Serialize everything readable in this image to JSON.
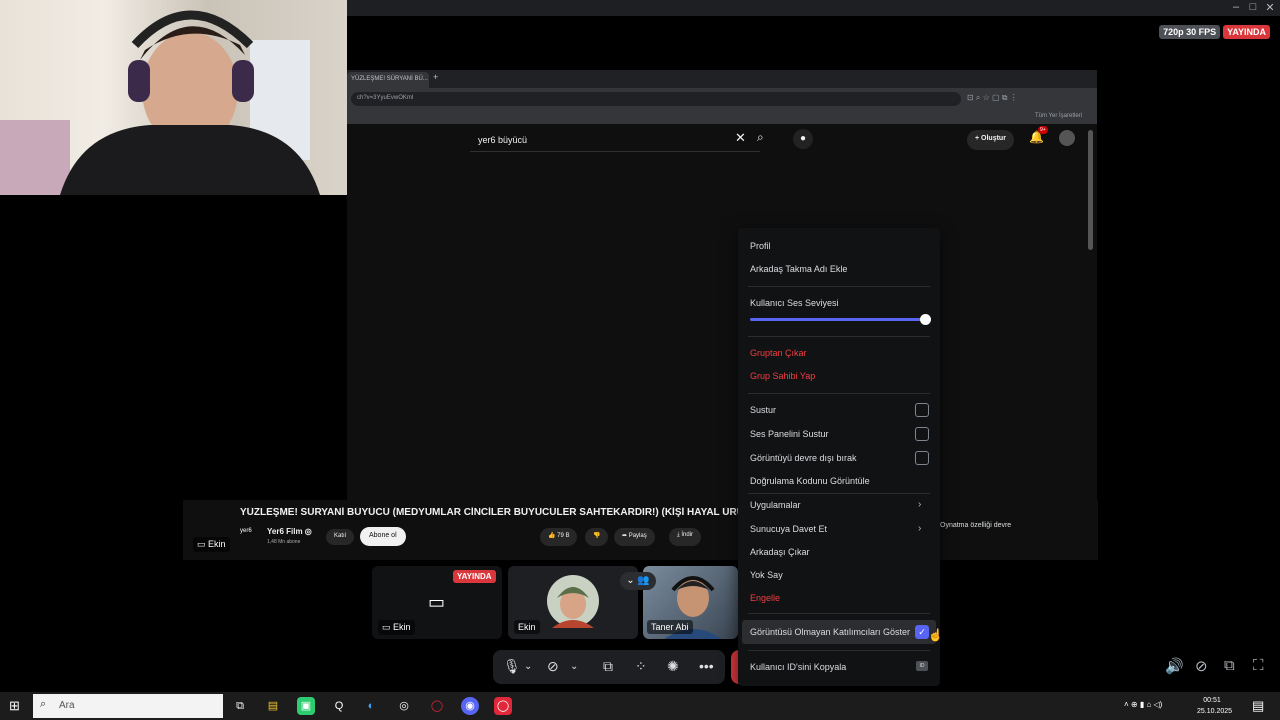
{
  "window": {
    "minimize": "–",
    "maximize": "□",
    "close": "✕"
  },
  "stream_badge": {
    "quality": "720p 30 FPS",
    "live": "YAYINDA"
  },
  "browser": {
    "tab_title": "YÜZLEŞME! SÜRYANİ BÜ...",
    "url": "ch?v=3YyuEvwOKml",
    "bookmarks_label": "Tüm Yer İşaretleri",
    "search_value": "yer6 büyücü",
    "create_label": "Oluştur",
    "bell_count": "9+"
  },
  "video": {
    "title": "YÜZLEŞME! SÜRYANİ BÜYÜCÜ (MEDYUMLAR CİNCİLER BÜYÜCÜLER SAHTEKARDIR!) (KİŞİ HAYAL ÜRÜNÜ",
    "channel_logo": "yer6",
    "channel": "Yer6 Film ◎",
    "subscribers": "1,48 Mn abone",
    "join": "Katıl",
    "subscribe": "Abone ol",
    "likes": "79 B",
    "share": "Paylaş",
    "download": "İndir"
  },
  "side_text": "Oynatma özelliği devre",
  "streamer_label": "Ekin",
  "participants": {
    "screen_label": "Ekin",
    "live": "YAYINDA",
    "ekin": "Ekin",
    "taner": "Taner Abi"
  },
  "context_menu": {
    "profile": "Profil",
    "nickname": "Arkadaş Takma Adı Ekle",
    "volume_label": "Kullanıcı Ses Seviyesi",
    "volume_level": 1.0,
    "remove_group": "Gruptan Çıkar",
    "make_owner": "Grup Sahibi Yap",
    "mute": "Sustur",
    "mute_soundboard": "Ses Panelini Sustur",
    "disable_video": "Görüntüyü devre dışı bırak",
    "verify_code": "Doğrulama Kodunu Görüntüle",
    "apps": "Uygulamalar",
    "invite_server": "Sunucuya Davet Et",
    "remove_friend": "Arkadaşı Çıkar",
    "ignore": "Yok Say",
    "block": "Engelle",
    "show_non_video": "Görüntüsü Olmayan Katılımcıları Göster",
    "show_non_video_checked": true,
    "copy_id": "Kullanıcı ID'sini Kopyala",
    "id_badge": "ID"
  },
  "taskbar": {
    "search_placeholder": "Ara",
    "time": "00:51",
    "date": "25.10.2025"
  },
  "colors": {
    "accent": "#5865f2",
    "danger": "#f23f43",
    "live": "#da373c"
  }
}
